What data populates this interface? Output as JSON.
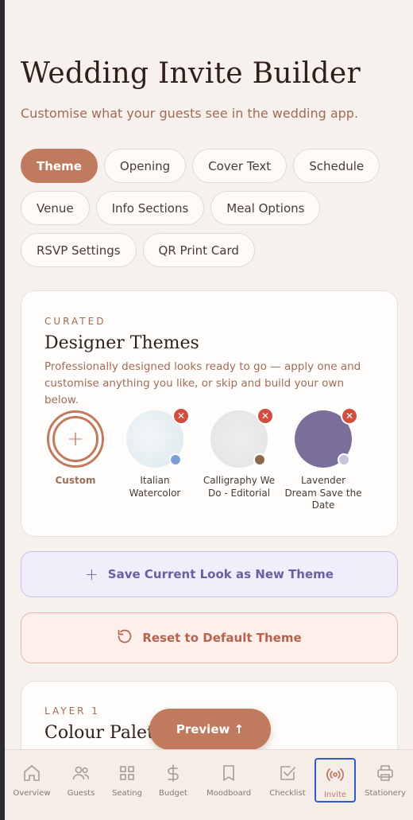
{
  "header": {
    "title": "Wedding Invite Builder",
    "subtitle": "Customise what your guests see in the wedding app."
  },
  "tabs": [
    {
      "label": "Theme",
      "active": true
    },
    {
      "label": "Opening"
    },
    {
      "label": "Cover Text"
    },
    {
      "label": "Schedule"
    },
    {
      "label": "Venue"
    },
    {
      "label": "Info Sections"
    },
    {
      "label": "Meal Options"
    },
    {
      "label": "RSVP Settings"
    },
    {
      "label": "QR Print Card"
    }
  ],
  "themes_card": {
    "eyebrow": "CURATED",
    "title": "Designer Themes",
    "description": "Professionally designed looks ready to go — apply one and customise anything you like, or skip and build your own below.",
    "items": [
      {
        "label": "Custom",
        "icon": "plus-icon"
      },
      {
        "label": "Italian Watercolor",
        "swatch_color": "#e6eef2",
        "dot_color": "#7aa0d4"
      },
      {
        "label": "Calligraphy We Do - Editorial",
        "swatch_color": "#e6e6e6",
        "dot_color": "#8b6a4c"
      },
      {
        "label": "Lavender Dream Save the Date",
        "swatch_color": "#7a6e9b",
        "dot_color": "#c8c3dc"
      }
    ]
  },
  "actions": {
    "save_theme": "Save Current Look as New Theme",
    "reset_theme": "Reset to Default Theme"
  },
  "layer_card": {
    "eyebrow": "LAYER 1",
    "title": "Colour Palette"
  },
  "preview_button": "Preview ↑",
  "bottom_nav": [
    {
      "label": "Overview",
      "icon": "home-icon"
    },
    {
      "label": "Guests",
      "icon": "users-icon"
    },
    {
      "label": "Seating",
      "icon": "grid-icon"
    },
    {
      "label": "Budget",
      "icon": "dollar-icon"
    },
    {
      "label": "Moodboard",
      "icon": "bookmark-icon"
    },
    {
      "label": "Checklist",
      "icon": "checkbox-icon"
    },
    {
      "label": "Invite",
      "icon": "broadcast-icon",
      "active": true
    },
    {
      "label": "Stationery",
      "icon": "printer-icon"
    }
  ],
  "colors": {
    "accent": "#c07b5f",
    "lavender_accent": "#6b5fa3",
    "reset_accent": "#b7624b",
    "background": "#f7f1ed"
  }
}
